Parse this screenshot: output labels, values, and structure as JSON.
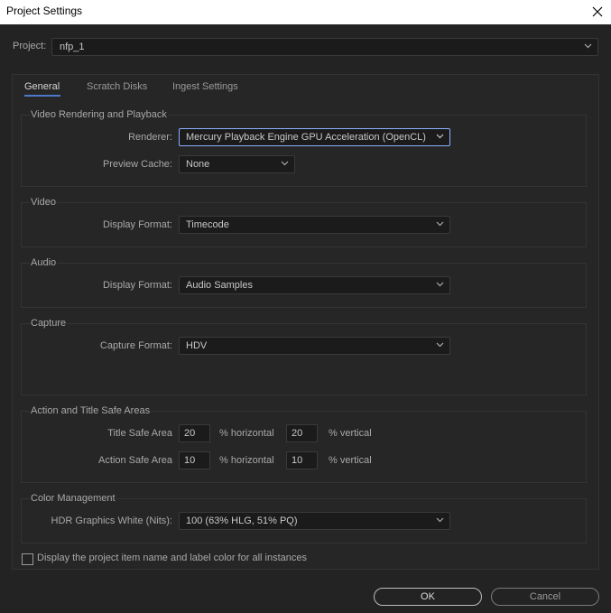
{
  "window": {
    "title": "Project Settings",
    "close_icon": "close-icon"
  },
  "project": {
    "label": "Project:",
    "value": "nfp_1"
  },
  "tabs": [
    {
      "label": "General",
      "active": true
    },
    {
      "label": "Scratch Disks",
      "active": false
    },
    {
      "label": "Ingest Settings",
      "active": false
    }
  ],
  "video_rendering": {
    "title": "Video Rendering and Playback",
    "renderer_label": "Renderer:",
    "renderer_value": "Mercury Playback Engine GPU Acceleration (OpenCL)",
    "preview_cache_label": "Preview Cache:",
    "preview_cache_value": "None"
  },
  "video": {
    "title": "Video",
    "display_format_label": "Display Format:",
    "display_format_value": "Timecode"
  },
  "audio": {
    "title": "Audio",
    "display_format_label": "Display Format:",
    "display_format_value": "Audio Samples"
  },
  "capture": {
    "title": "Capture",
    "capture_format_label": "Capture Format:",
    "capture_format_value": "HDV"
  },
  "safe_areas": {
    "title": "Action and Title Safe Areas",
    "title_safe_label": "Title Safe Area",
    "title_safe_horizontal": "20",
    "title_safe_vertical": "20",
    "action_safe_label": "Action Safe Area",
    "action_safe_horizontal": "10",
    "action_safe_vertical": "10",
    "horizontal_unit": "% horizontal",
    "vertical_unit": "% vertical"
  },
  "color_management": {
    "title": "Color Management",
    "hdr_label": "HDR Graphics White (Nits):",
    "hdr_value": "100 (63% HLG, 51% PQ)"
  },
  "checkbox": {
    "label": "Display the project item name and label color for all instances",
    "checked": false
  },
  "buttons": {
    "ok": "OK",
    "cancel": "Cancel"
  },
  "colors": {
    "background": "#232323",
    "panel": "#262626",
    "field": "#1b1b1b",
    "accent": "#4d78cc",
    "focus_border": "#8ab0ff"
  }
}
